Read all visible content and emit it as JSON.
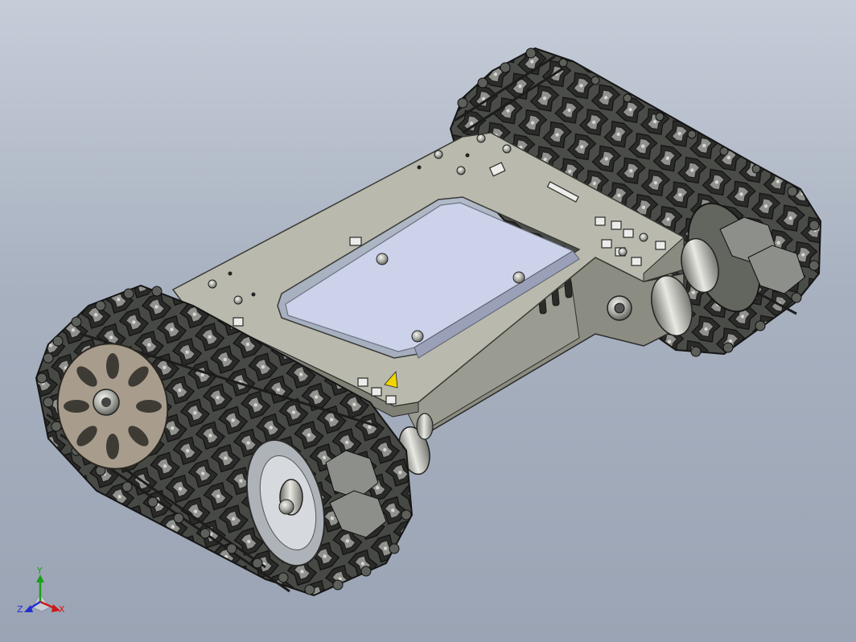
{
  "triad": {
    "x_label": "X",
    "y_label": "Y",
    "z_label": "Z",
    "colors": {
      "x": "#d01818",
      "y": "#18a018",
      "z": "#2030d0"
    }
  },
  "model": {
    "plate_color": "#b7b8aa",
    "battery_color": "#ccd2ea",
    "track_color": "#3b3d3a",
    "warning_color": "#f2d400"
  }
}
